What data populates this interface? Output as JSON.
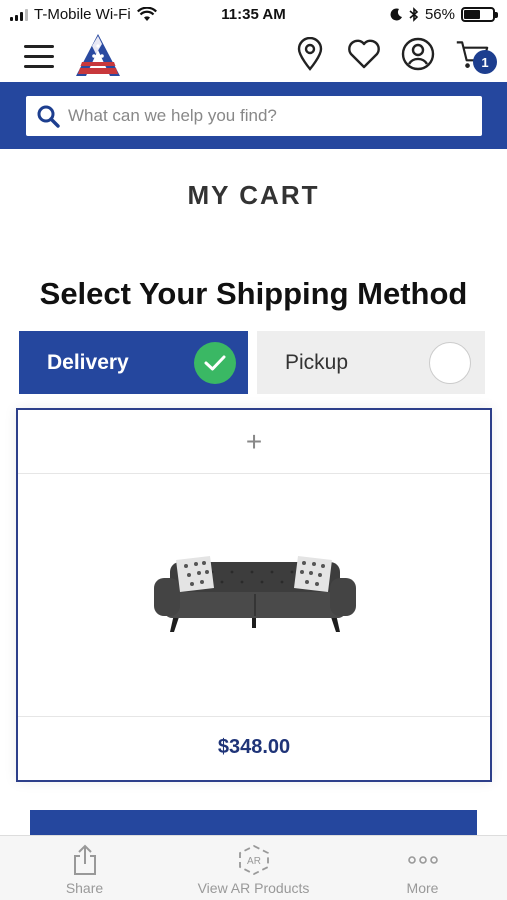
{
  "status_bar": {
    "carrier": "T-Mobile Wi-Fi",
    "time": "11:35 AM",
    "battery": "56%",
    "battery_level": 0.56
  },
  "header": {
    "cart_count": "1",
    "icons": [
      "menu-icon",
      "logo",
      "location-pin-icon",
      "heart-icon",
      "account-icon",
      "cart-icon"
    ]
  },
  "search": {
    "placeholder": "What can we help you find?",
    "value": ""
  },
  "page": {
    "title": "MY CART",
    "shipping_title": "Select Your Shipping Method"
  },
  "shipping": {
    "delivery_label": "Delivery",
    "pickup_label": "Pickup",
    "selected": "Delivery"
  },
  "product": {
    "expand_symbol": "+",
    "price": "$348.00"
  },
  "bottom_bar": {
    "items": [
      {
        "label": "Share",
        "icon": "share-icon"
      },
      {
        "label": "View AR Products",
        "icon": "ar-icon"
      },
      {
        "label": "More",
        "icon": "more-icon"
      }
    ]
  },
  "colors": {
    "brand_blue": "#25479e",
    "check_green": "#3ab864",
    "price_blue": "#1f3478"
  }
}
